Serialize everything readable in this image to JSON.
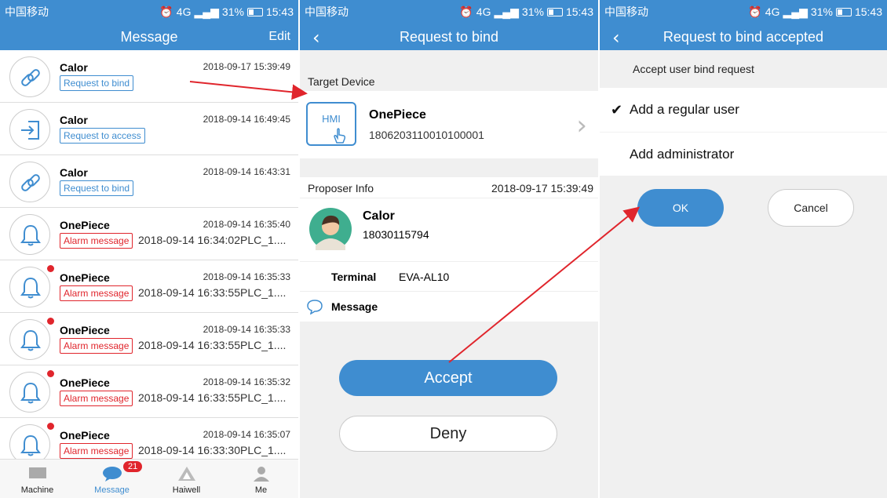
{
  "status_bar": {
    "carrier": "中国移动",
    "network": "4G",
    "battery": "31%",
    "time": "15:43"
  },
  "screen1": {
    "title": "Message",
    "edit_label": "Edit",
    "messages": [
      {
        "name": "Calor",
        "time": "2018-09-17 15:39:49",
        "tag": "Request to bind",
        "tag_type": "blue",
        "icon": "link-icon",
        "preview": "",
        "unread": false
      },
      {
        "name": "Calor",
        "time": "2018-09-14 16:49:45",
        "tag": "Request to access",
        "tag_type": "blue",
        "icon": "login-icon",
        "preview": "",
        "unread": false
      },
      {
        "name": "Calor",
        "time": "2018-09-14 16:43:31",
        "tag": "Request to bind",
        "tag_type": "blue",
        "icon": "link-icon",
        "preview": "",
        "unread": false
      },
      {
        "name": "OnePiece",
        "time": "2018-09-14 16:35:40",
        "tag": "Alarm message",
        "tag_type": "red",
        "icon": "bell-icon",
        "preview": "2018-09-14 16:34:02PLC_1....",
        "unread": false
      },
      {
        "name": "OnePiece",
        "time": "2018-09-14 16:35:33",
        "tag": "Alarm message",
        "tag_type": "red",
        "icon": "bell-icon",
        "preview": "2018-09-14 16:33:55PLC_1....",
        "unread": true
      },
      {
        "name": "OnePiece",
        "time": "2018-09-14 16:35:33",
        "tag": "Alarm message",
        "tag_type": "red",
        "icon": "bell-icon",
        "preview": "2018-09-14 16:33:55PLC_1....",
        "unread": true
      },
      {
        "name": "OnePiece",
        "time": "2018-09-14 16:35:32",
        "tag": "Alarm message",
        "tag_type": "red",
        "icon": "bell-icon",
        "preview": "2018-09-14 16:33:55PLC_1....",
        "unread": true
      },
      {
        "name": "OnePiece",
        "time": "2018-09-14 16:35:07",
        "tag": "Alarm message",
        "tag_type": "red",
        "icon": "bell-icon",
        "preview": "2018-09-14 16:33:30PLC_1....",
        "unread": true
      }
    ],
    "tabs": [
      {
        "label": "Machine",
        "icon": "machine-icon"
      },
      {
        "label": "Message",
        "icon": "chat-icon",
        "badge": "21",
        "active": true
      },
      {
        "label": "Haiwell",
        "icon": "haiwell-logo-icon"
      },
      {
        "label": "Me",
        "icon": "person-icon"
      }
    ]
  },
  "screen2": {
    "title": "Request to bind",
    "target_label": "Target Device",
    "device_icon_text": "HMI",
    "device_name": "OnePiece",
    "device_id": "1806203110010100001",
    "proposer_label": "Proposer Info",
    "proposer_time": "2018-09-17 15:39:49",
    "user_name": "Calor",
    "user_phone": "18030115794",
    "terminal_label": "Terminal",
    "terminal_value": "EVA-AL10",
    "message_label": "Message",
    "accept_label": "Accept",
    "deny_label": "Deny"
  },
  "screen3": {
    "title": "Request to bind accepted",
    "prompt": "Accept user bind request",
    "options": [
      "Add a regular user",
      "Add administrator"
    ],
    "selected_option": 0,
    "ok_label": "OK",
    "cancel_label": "Cancel"
  },
  "colors": {
    "primary": "#3f8dd0",
    "alert": "#e0252c",
    "annotation_arrow": "#e0252c"
  }
}
